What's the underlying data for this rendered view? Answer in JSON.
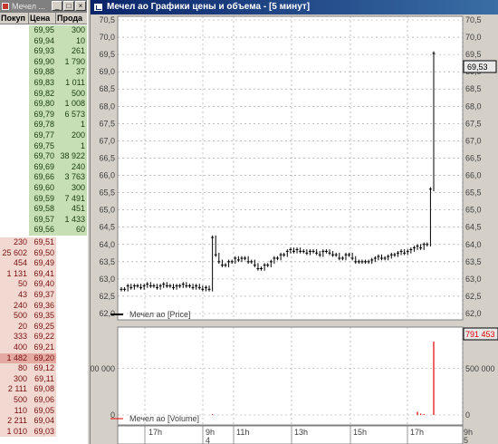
{
  "orderbook": {
    "title": "Мечел ...",
    "columns": [
      "Покуп",
      "Цена",
      "Прода"
    ],
    "sell": [
      [
        "69,95",
        "300"
      ],
      [
        "69,94",
        "10"
      ],
      [
        "69,93",
        "261"
      ],
      [
        "69,90",
        "1 790"
      ],
      [
        "69,88",
        "37"
      ],
      [
        "69,83",
        "1 011"
      ],
      [
        "69,82",
        "500"
      ],
      [
        "69,80",
        "1 008"
      ],
      [
        "69,79",
        "6 573"
      ],
      [
        "69,78",
        "1"
      ],
      [
        "69,77",
        "200"
      ],
      [
        "69,75",
        "1"
      ],
      [
        "69,70",
        "38 922"
      ],
      [
        "69,69",
        "240"
      ],
      [
        "69,66",
        "3 763"
      ],
      [
        "69,60",
        "300"
      ],
      [
        "69,59",
        "7 491"
      ],
      [
        "69,58",
        "451"
      ],
      [
        "69,57",
        "1 433"
      ],
      [
        "69,56",
        "60"
      ]
    ],
    "buy": [
      [
        "230",
        "69,51"
      ],
      [
        "25 602",
        "69,50"
      ],
      [
        "454",
        "69,49"
      ],
      [
        "1 131",
        "69,41"
      ],
      [
        "50",
        "69,40"
      ],
      [
        "43",
        "69,37"
      ],
      [
        "240",
        "69,36"
      ],
      [
        "500",
        "69,35"
      ],
      [
        "20",
        "69,25"
      ],
      [
        "333",
        "69,22"
      ],
      [
        "400",
        "69,21"
      ],
      [
        "1 482",
        "69,20"
      ],
      [
        "80",
        "69,12"
      ],
      [
        "300",
        "69,11"
      ],
      [
        "2 111",
        "69,08"
      ],
      [
        "500",
        "69,06"
      ],
      [
        "110",
        "69,05"
      ],
      [
        "2 211",
        "69,04"
      ],
      [
        "1 010",
        "69,03"
      ]
    ]
  },
  "chart_window": {
    "title": "Мечел ао Графики цены и объема - [5 минут]",
    "price_legend": "Мечел ао [Price]",
    "volume_legend": "Мечел ао [Volume]",
    "last_price_label": "69,53",
    "last_volume_label": "791 453",
    "colors": {
      "price_line": "#000000",
      "volume_bar": "#e00000",
      "grid": "#9a9a9a"
    }
  },
  "chart_data": [
    {
      "type": "line",
      "series": [
        {
          "name": "Мечел ао [Price]",
          "values": [
            62.7,
            62.7,
            62.8,
            62.75,
            62.8,
            62.8,
            62.75,
            62.8,
            62.85,
            62.8,
            62.8,
            62.75,
            62.8,
            62.85,
            62.8,
            62.8,
            62.75,
            62.8,
            62.8,
            62.85,
            62.8,
            62.8,
            62.75,
            62.8,
            62.75,
            62.7,
            62.75,
            62.7,
            64.2,
            63.7,
            63.5,
            63.4,
            63.4,
            63.5,
            63.5,
            63.6,
            63.55,
            63.6,
            63.6,
            63.5,
            63.5,
            63.4,
            63.3,
            63.3,
            63.4,
            63.4,
            63.5,
            63.6,
            63.6,
            63.7,
            63.7,
            63.8,
            63.85,
            63.8,
            63.85,
            63.8,
            63.8,
            63.75,
            63.8,
            63.8,
            63.75,
            63.7,
            63.8,
            63.8,
            63.75,
            63.7,
            63.7,
            63.6,
            63.6,
            63.7,
            63.7,
            63.6,
            63.5,
            63.5,
            63.5,
            63.5,
            63.5,
            63.55,
            63.6,
            63.65,
            63.6,
            63.6,
            63.65,
            63.7,
            63.7,
            63.75,
            63.8,
            63.75,
            63.8,
            63.85,
            63.9,
            63.95,
            63.9,
            64.0,
            64.0,
            65.6,
            69.53
          ]
        }
      ],
      "ylim": [
        62,
        70.5
      ],
      "y_ticks": [
        "70,5",
        "70,0",
        "69,5",
        "69,0",
        "68,5",
        "68,0",
        "67,5",
        "67,0",
        "66,5",
        "66,0",
        "65,5",
        "65,0",
        "64,5",
        "64,0",
        "63,5",
        "63,0",
        "62,5",
        "62,0"
      ],
      "grid": true
    },
    {
      "type": "bar",
      "series": [
        {
          "name": "Мечел ао [Volume]",
          "values": [
            0,
            0,
            0,
            0,
            0,
            0,
            0,
            0,
            0,
            0,
            0,
            0,
            0,
            0,
            0,
            0,
            0,
            0,
            0,
            0,
            0,
            0,
            0,
            0,
            0,
            0,
            0,
            0,
            8000,
            0,
            0,
            0,
            0,
            0,
            0,
            0,
            0,
            0,
            0,
            0,
            0,
            0,
            0,
            0,
            0,
            0,
            0,
            0,
            0,
            0,
            0,
            0,
            0,
            0,
            0,
            0,
            0,
            0,
            0,
            0,
            0,
            0,
            0,
            0,
            0,
            0,
            0,
            0,
            0,
            0,
            0,
            0,
            0,
            0,
            0,
            0,
            0,
            0,
            0,
            0,
            0,
            0,
            0,
            0,
            0,
            0,
            0,
            0,
            0,
            0,
            0,
            35000,
            15000,
            10000,
            0,
            0,
            791453
          ]
        }
      ],
      "y_ticks": [
        "500 000",
        "0"
      ],
      "ylim": [
        0,
        800000
      ],
      "grid": true
    }
  ],
  "time_axis": {
    "labels": [
      "17h",
      "9h",
      "11h",
      "13h",
      "15h",
      "17h",
      "9h"
    ],
    "day_labels": [
      "4",
      "5"
    ]
  }
}
